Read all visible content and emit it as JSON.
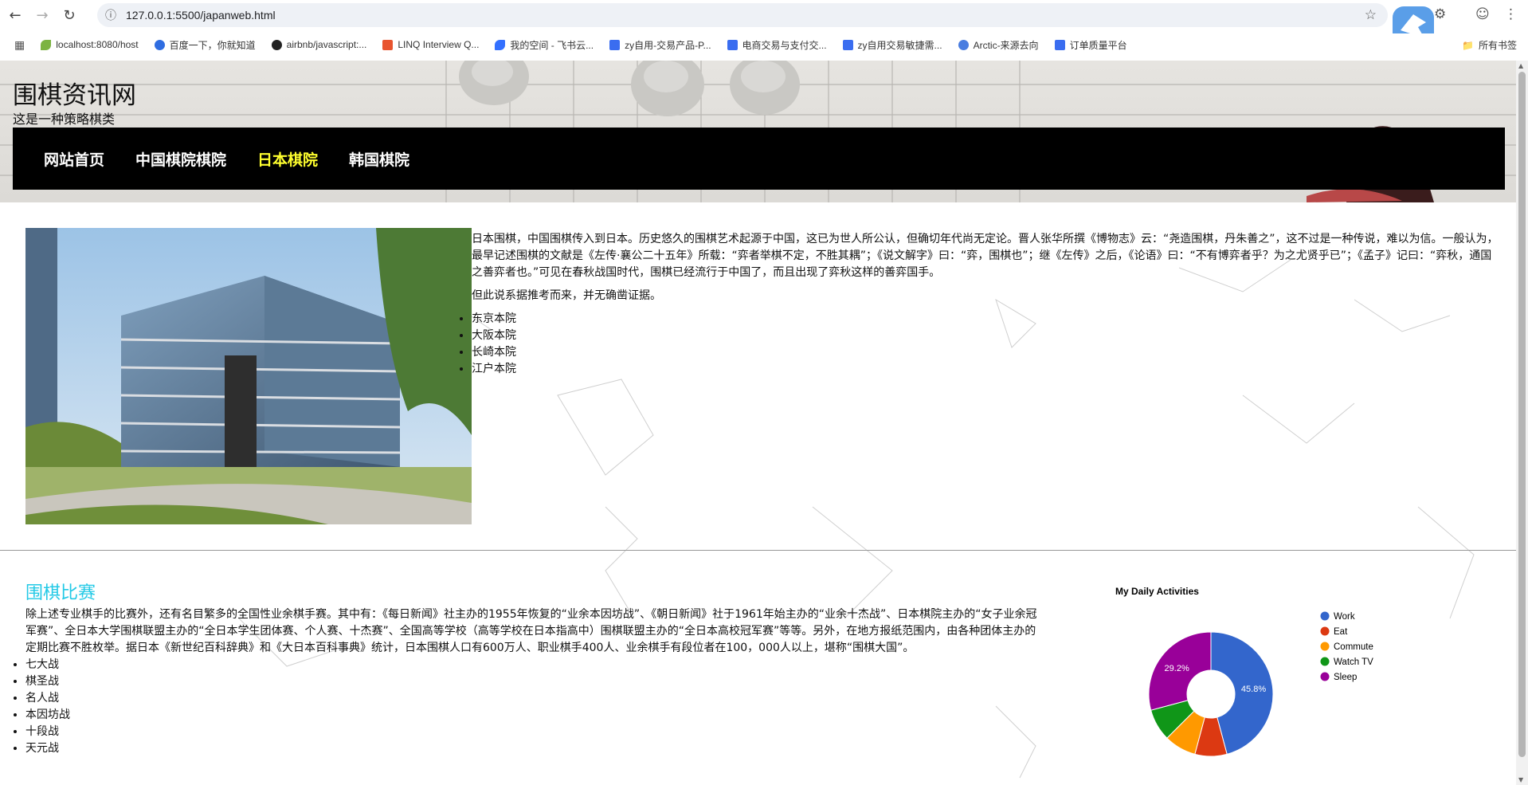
{
  "browser": {
    "url": "127.0.0.1:5500/japanweb.html",
    "bookmarks": [
      {
        "label": "localhost:8080/host",
        "color": "#7cb342"
      },
      {
        "label": "百度一下，你就知道",
        "color": "#2f6de1"
      },
      {
        "label": "airbnb/javascript:...",
        "color": "#222222"
      },
      {
        "label": "LINQ Interview Q...",
        "color": "#e8542f"
      },
      {
        "label": "我的空间 - 飞书云...",
        "color": "#3370ff"
      },
      {
        "label": "zy自用-交易产品-P...",
        "color": "#3a6df0"
      },
      {
        "label": "电商交易与支付交...",
        "color": "#3a6df0"
      },
      {
        "label": "zy自用交易敏捷需...",
        "color": "#3a6df0"
      },
      {
        "label": "Arctic-来源去向",
        "color": "#4a7de0"
      },
      {
        "label": "订单质量平台",
        "color": "#3a6df0"
      }
    ],
    "all_bookmarks": "所有书签"
  },
  "header": {
    "title": "围棋资讯网",
    "subtitle": "这是一种策略棋类",
    "nav": [
      {
        "label": "网站首页",
        "active": false
      },
      {
        "label": "中国棋院棋院",
        "active": false
      },
      {
        "label": "日本棋院",
        "active": true
      },
      {
        "label": "韩国棋院",
        "active": false
      }
    ]
  },
  "intro": {
    "paragraph1": "日本围棋，中国围棋传入到日本。历史悠久的围棋艺术起源于中国，这已为世人所公认，但确切年代尚无定论。晋人张华所撰《博物志》云：“尧造围棋，丹朱善之”，这不过是一种传说，难以为信。一般认为，最早记述围棋的文献是《左传·襄公二十五年》所载：“弈者举棋不定，不胜其耦”；《说文解字》曰：“弈，围棋也”；继《左传》之后，《论语》曰：“不有博弈者乎？为之尤贤乎已”；《孟子》记曰：“弈秋，通国之善弈者也。”可见在春秋战国时代，围棋已经流行于中国了，而且出现了弈秋这样的善弈国手。",
    "paragraph2": "但此说系据推考而来，并无确凿证据。",
    "list": [
      "东京本院",
      "大阪本院",
      "长崎本院",
      "江户本院"
    ]
  },
  "section": {
    "title": "围棋比赛",
    "paragraph": "除上述专业棋手的比赛外，还有名目繁多的全国性业余棋手赛。其中有：《每日新闻》社主办的1955年恢复的“业余本因坊战”、《朝日新闻》社于1961年始主办的“业余十杰战”、日本棋院主办的“女子业余冠军赛”、全日本大学围棋联盟主办的“全日本学生团体赛、个人赛、十杰赛”、全国高等学校（高等学校在日本指高中）围棋联盟主办的“全日本高校冠军赛”等等。另外，在地方报纸范围内，由各种团体主办的定期比赛不胜枚举。据日本《新世纪百科辞典》和《大日本百科事典》统计，日本围棋人口有600万人、职业棋手400人、业余棋手有段位者在100，000人以上，堪称“围棋大国”。",
    "list": [
      "七大战",
      "棋圣战",
      "名人战",
      "本因坊战",
      "十段战",
      "天元战"
    ]
  },
  "chart_data": {
    "type": "pie",
    "title": "My Daily Activities",
    "donut": true,
    "categories": [
      "Work",
      "Eat",
      "Commute",
      "Watch TV",
      "Sleep"
    ],
    "values": [
      11,
      2,
      2,
      2,
      7
    ],
    "labels": [
      "45.8%",
      "",
      "",
      "",
      "29.2%"
    ],
    "colors": [
      "#3366cc",
      "#dc3912",
      "#ff9900",
      "#109618",
      "#990099"
    ],
    "legend": "right"
  }
}
